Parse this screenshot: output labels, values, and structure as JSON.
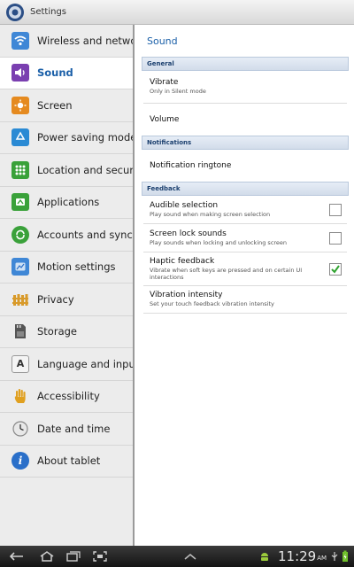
{
  "app": {
    "title": "Settings",
    "icon": "settings-gear-icon"
  },
  "sidebar": {
    "items": [
      {
        "label": "Wireless and networks",
        "icon": "wifi-icon",
        "color": "#3f87d6"
      },
      {
        "label": "Sound",
        "icon": "speaker-icon",
        "color": "#7a3fb0",
        "active": true
      },
      {
        "label": "Screen",
        "icon": "brightness-icon",
        "color": "#e58a1f"
      },
      {
        "label": "Power saving mode",
        "icon": "recycle-icon",
        "color": "#2a8ad4"
      },
      {
        "label": "Location and security",
        "icon": "grid-icon",
        "color": "#3aa13a"
      },
      {
        "label": "Applications",
        "icon": "applications-icon",
        "color": "#3aa13a"
      },
      {
        "label": "Accounts and sync",
        "icon": "sync-icon",
        "color": "#3aa13a"
      },
      {
        "label": "Motion settings",
        "icon": "motion-icon",
        "color": "#3f87d6"
      },
      {
        "label": "Privacy",
        "icon": "privacy-fence-icon",
        "color": "#d89a2a"
      },
      {
        "label": "Storage",
        "icon": "sd-card-icon",
        "color": "#555555"
      },
      {
        "label": "Language and input",
        "icon": "keyboard-a-icon",
        "color": "#888888"
      },
      {
        "label": "Accessibility",
        "icon": "hand-icon",
        "color": "#e0a020"
      },
      {
        "label": "Date and time",
        "icon": "clock-icon",
        "color": "#999999"
      },
      {
        "label": "About tablet",
        "icon": "info-icon",
        "color": "#2a6fc9"
      }
    ]
  },
  "main": {
    "title": "Sound",
    "sections": [
      {
        "header": "General",
        "rows": [
          {
            "title": "Vibrate",
            "summary": "Only in Silent mode"
          },
          {
            "title": "Volume",
            "summary": ""
          }
        ]
      },
      {
        "header": "Notifications",
        "rows": [
          {
            "title": "Notification ringtone",
            "summary": ""
          }
        ]
      },
      {
        "header": "Feedback",
        "rows": [
          {
            "title": "Audible selection",
            "summary": "Play sound when making screen selection",
            "checkbox": true,
            "checked": false
          },
          {
            "title": "Screen lock sounds",
            "summary": "Play sounds when locking and unlocking screen",
            "checkbox": true,
            "checked": false
          },
          {
            "title": "Haptic feedback",
            "summary": "Vibrate when soft keys are pressed and on certain UI interactions",
            "checkbox": true,
            "checked": true
          },
          {
            "title": "Vibration intensity",
            "summary": "Set your touch feedback vibration intensity"
          }
        ]
      }
    ]
  },
  "statusbar": {
    "time": "11:29",
    "ampm": "AM"
  },
  "colors": {
    "accent": "#1a5fa8",
    "check": "#2fa32f"
  }
}
